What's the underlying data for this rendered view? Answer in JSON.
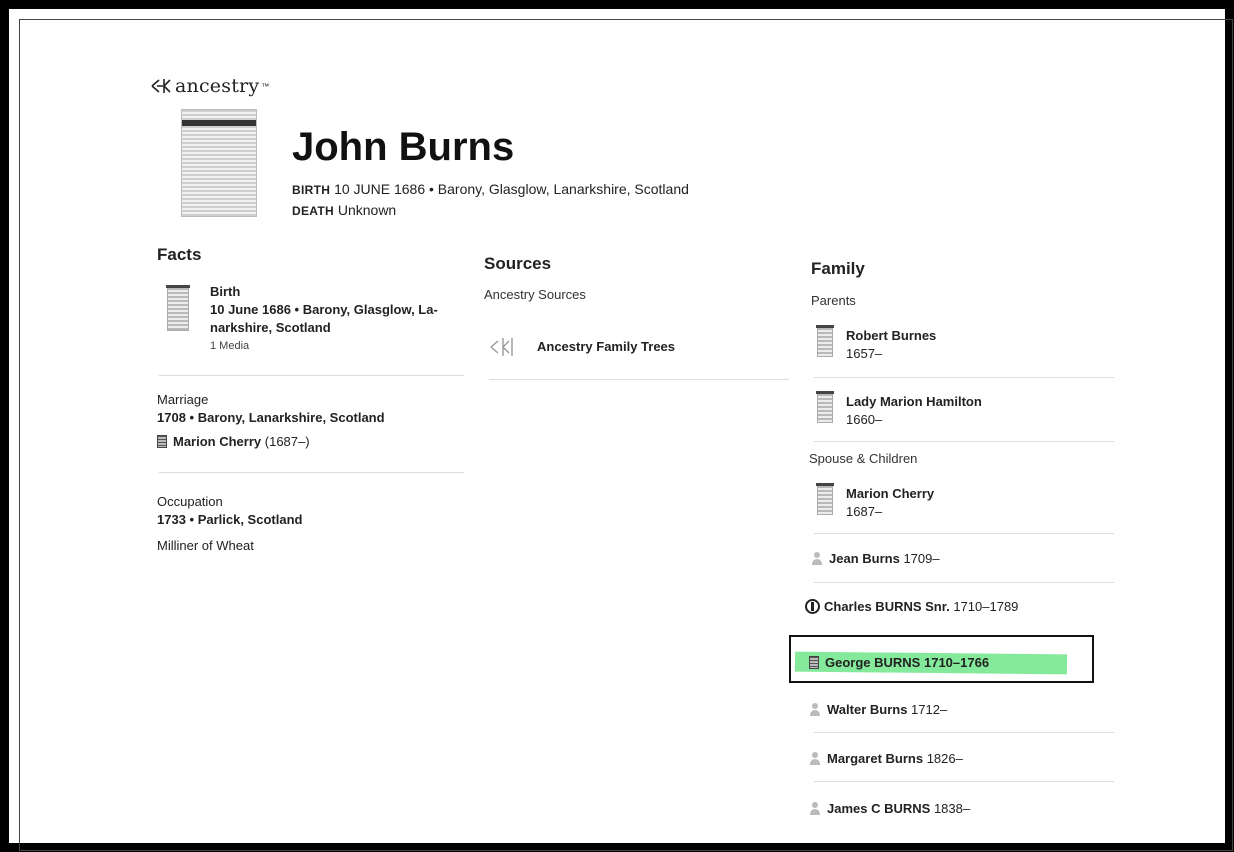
{
  "brand": {
    "logo_text": "ancestry",
    "tm": "™"
  },
  "person": {
    "name": "John Burns",
    "birth_label": "BIRTH",
    "birth_value": "10 JUNE 1686 • Barony, Glasglow, Lanarkshire, Scotland",
    "death_label": "DEATH",
    "death_value": "Unknown"
  },
  "facts": {
    "heading": "Facts",
    "birth": {
      "title": "Birth",
      "line1": "10 June 1686 • Barony, Glasglow, La-",
      "line2": "narkshire, Scotland",
      "media": "1 Media"
    },
    "marriage": {
      "title": "Marriage",
      "detail": "1708 • Barony, Lanarkshire, Scotland",
      "spouse_name": "Marion Cherry",
      "spouse_years": "(1687–)"
    },
    "occupation": {
      "title": "Occupation",
      "detail": "1733 • Parlick, Scotland",
      "description": "Milliner of Wheat"
    }
  },
  "sources": {
    "heading": "Sources",
    "subheading": "Ancestry Sources",
    "item": "Ancestry Family Trees"
  },
  "family": {
    "heading": "Family",
    "parents_label": "Parents",
    "parents": [
      {
        "name": "Robert Burnes",
        "years": "1657–"
      },
      {
        "name": "Lady Marion Hamilton",
        "years": "1660–"
      }
    ],
    "spouse_children_label": "Spouse & Children",
    "spouse": {
      "name": "Marion Cherry",
      "years": "1687–"
    },
    "children": [
      {
        "name": "Jean Burns",
        "years": "1709–"
      },
      {
        "name": "Charles BURNS Snr.",
        "years": "1710–1789"
      },
      {
        "name": "George BURNS",
        "years": "1710–1766"
      },
      {
        "name": "Walter Burns",
        "years": "1712–"
      },
      {
        "name": "Margaret Burns",
        "years": "1826–"
      },
      {
        "name": "James C BURNS",
        "years": "1838–"
      }
    ]
  }
}
